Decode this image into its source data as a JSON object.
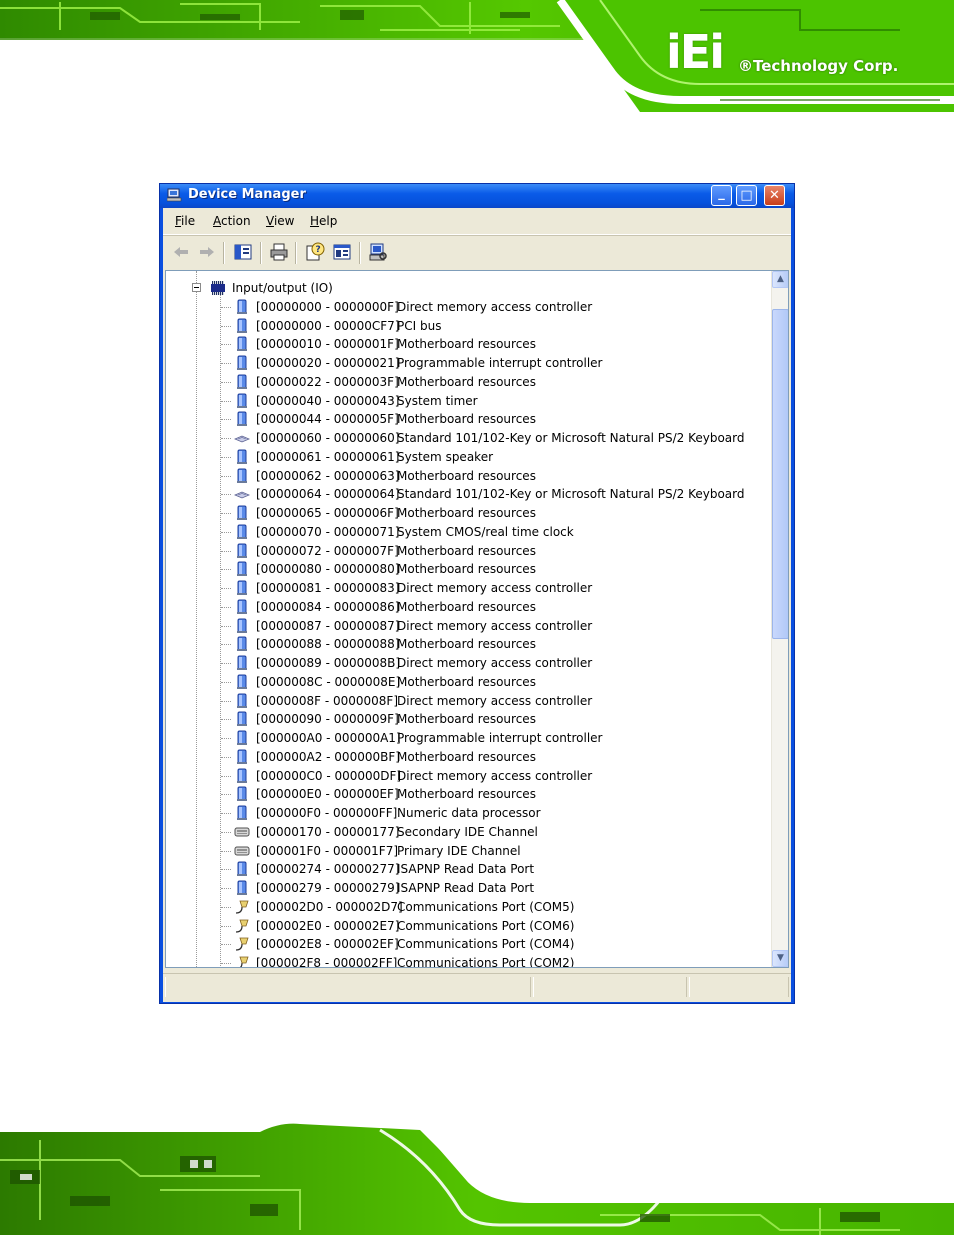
{
  "brand": {
    "logo_mark": "iEi",
    "company": "®Technology Corp."
  },
  "window": {
    "title": "Device Manager",
    "controls": {
      "minimize": "_",
      "maximize": "□",
      "close": "✕"
    },
    "menu": [
      {
        "label": "File",
        "key": "F",
        "rest": "ile"
      },
      {
        "label": "Action",
        "key": "A",
        "rest": "ction"
      },
      {
        "label": "View",
        "key": "V",
        "rest": "iew"
      },
      {
        "label": "Help",
        "key": "H",
        "rest": "elp"
      }
    ],
    "toolbar": [
      "back-icon",
      "forward-icon",
      "show-hide-console-tree-icon",
      "print-icon",
      "help-icon",
      "properties-icon",
      "scan-hardware-icon"
    ]
  },
  "tree": {
    "root": {
      "label": "Input/output (IO)",
      "icon": "chip-icon",
      "expanded": true
    },
    "children": [
      {
        "range": "[00000000 - 0000000F]",
        "device": "Direct memory access controller",
        "icon": "system-device-icon"
      },
      {
        "range": "[00000000 - 00000CF7]",
        "device": "PCI bus",
        "icon": "system-device-icon"
      },
      {
        "range": "[00000010 - 0000001F]",
        "device": "Motherboard resources",
        "icon": "system-device-icon"
      },
      {
        "range": "[00000020 - 00000021]",
        "device": "Programmable interrupt controller",
        "icon": "system-device-icon"
      },
      {
        "range": "[00000022 - 0000003F]",
        "device": "Motherboard resources",
        "icon": "system-device-icon"
      },
      {
        "range": "[00000040 - 00000043]",
        "device": "System timer",
        "icon": "system-device-icon"
      },
      {
        "range": "[00000044 - 0000005F]",
        "device": "Motherboard resources",
        "icon": "system-device-icon"
      },
      {
        "range": "[00000060 - 00000060]",
        "device": "Standard 101/102-Key or Microsoft Natural PS/2 Keyboard",
        "icon": "keyboard-icon"
      },
      {
        "range": "[00000061 - 00000061]",
        "device": "System speaker",
        "icon": "system-device-icon"
      },
      {
        "range": "[00000062 - 00000063]",
        "device": "Motherboard resources",
        "icon": "system-device-icon"
      },
      {
        "range": "[00000064 - 00000064]",
        "device": "Standard 101/102-Key or Microsoft Natural PS/2 Keyboard",
        "icon": "keyboard-icon"
      },
      {
        "range": "[00000065 - 0000006F]",
        "device": "Motherboard resources",
        "icon": "system-device-icon"
      },
      {
        "range": "[00000070 - 00000071]",
        "device": "System CMOS/real time clock",
        "icon": "system-device-icon"
      },
      {
        "range": "[00000072 - 0000007F]",
        "device": "Motherboard resources",
        "icon": "system-device-icon"
      },
      {
        "range": "[00000080 - 00000080]",
        "device": "Motherboard resources",
        "icon": "system-device-icon"
      },
      {
        "range": "[00000081 - 00000083]",
        "device": "Direct memory access controller",
        "icon": "system-device-icon"
      },
      {
        "range": "[00000084 - 00000086]",
        "device": "Motherboard resources",
        "icon": "system-device-icon"
      },
      {
        "range": "[00000087 - 00000087]",
        "device": "Direct memory access controller",
        "icon": "system-device-icon"
      },
      {
        "range": "[00000088 - 00000088]",
        "device": "Motherboard resources",
        "icon": "system-device-icon"
      },
      {
        "range": "[00000089 - 0000008B]",
        "device": "Direct memory access controller",
        "icon": "system-device-icon"
      },
      {
        "range": "[0000008C - 0000008E]",
        "device": "Motherboard resources",
        "icon": "system-device-icon"
      },
      {
        "range": "[0000008F - 0000008F]",
        "device": "Direct memory access controller",
        "icon": "system-device-icon"
      },
      {
        "range": "[00000090 - 0000009F]",
        "device": "Motherboard resources",
        "icon": "system-device-icon"
      },
      {
        "range": "[000000A0 - 000000A1]",
        "device": "Programmable interrupt controller",
        "icon": "system-device-icon"
      },
      {
        "range": "[000000A2 - 000000BF]",
        "device": "Motherboard resources",
        "icon": "system-device-icon"
      },
      {
        "range": "[000000C0 - 000000DF]",
        "device": "Direct memory access controller",
        "icon": "system-device-icon"
      },
      {
        "range": "[000000E0 - 000000EF]",
        "device": "Motherboard resources",
        "icon": "system-device-icon"
      },
      {
        "range": "[000000F0 - 000000FF]",
        "device": "Numeric data processor",
        "icon": "system-device-icon"
      },
      {
        "range": "[00000170 - 00000177]",
        "device": "Secondary IDE Channel",
        "icon": "ide-controller-icon"
      },
      {
        "range": "[000001F0 - 000001F7]",
        "device": "Primary IDE Channel",
        "icon": "ide-controller-icon"
      },
      {
        "range": "[00000274 - 00000277]",
        "device": "ISAPNP Read Data Port",
        "icon": "system-device-icon"
      },
      {
        "range": "[00000279 - 00000279]",
        "device": "ISAPNP Read Data Port",
        "icon": "system-device-icon"
      },
      {
        "range": "[000002D0 - 000002D7]",
        "device": "Communications Port (COM5)",
        "icon": "com-port-icon"
      },
      {
        "range": "[000002E0 - 000002E7]",
        "device": "Communications Port (COM6)",
        "icon": "com-port-icon"
      },
      {
        "range": "[000002E8 - 000002EF]",
        "device": "Communications Port (COM4)",
        "icon": "com-port-icon"
      },
      {
        "range": "[000002F8 - 000002FF]",
        "device": "Communications Port (COM2)",
        "icon": "com-port-icon"
      }
    ]
  },
  "colors": {
    "title_bar": "#0a5be8",
    "circuit_green": "#4fcf00",
    "window_face": "#ece9d8",
    "tree_border": "#7f9db9"
  }
}
